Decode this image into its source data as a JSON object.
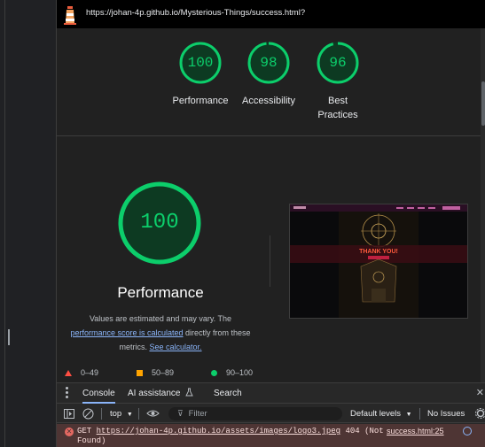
{
  "url": "https://johan-4p.github.io/Mysterious-Things/success.html?",
  "categories": [
    {
      "score": "100",
      "label": "Performance",
      "fraction": 1.0
    },
    {
      "score": "98",
      "label": "Accessibility",
      "fraction": 0.98
    },
    {
      "score": "96",
      "label_line1": "Best",
      "label_line2": "Practices",
      "fraction": 0.96
    }
  ],
  "performance": {
    "score": "100",
    "title": "Performance",
    "note_pre": "Values are estimated and may vary. The",
    "note_link1": "performance score is calculated",
    "note_mid": " directly from these metrics. ",
    "note_link2": "See calculator."
  },
  "legend": {
    "fail": "0–49",
    "average": "50–89",
    "pass": "90–100"
  },
  "colors": {
    "pass": "#0cce6b",
    "average": "#ffa400",
    "fail": "#ff4e42",
    "link": "#8ab4f8"
  },
  "drawer": {
    "tabs": [
      "Console",
      "AI assistance",
      "Search"
    ],
    "context": "top",
    "filter_placeholder": "Filter",
    "levels": "Default levels",
    "issues": "No Issues"
  },
  "error": {
    "method": "GET",
    "url": "https://johan-4p.github.io/assets/images/logo3.jpeg",
    "status": "404 (Not",
    "status2": "Found)",
    "source": "success.html:25"
  },
  "thumbnail": {
    "heading": "THANK YOU!"
  }
}
